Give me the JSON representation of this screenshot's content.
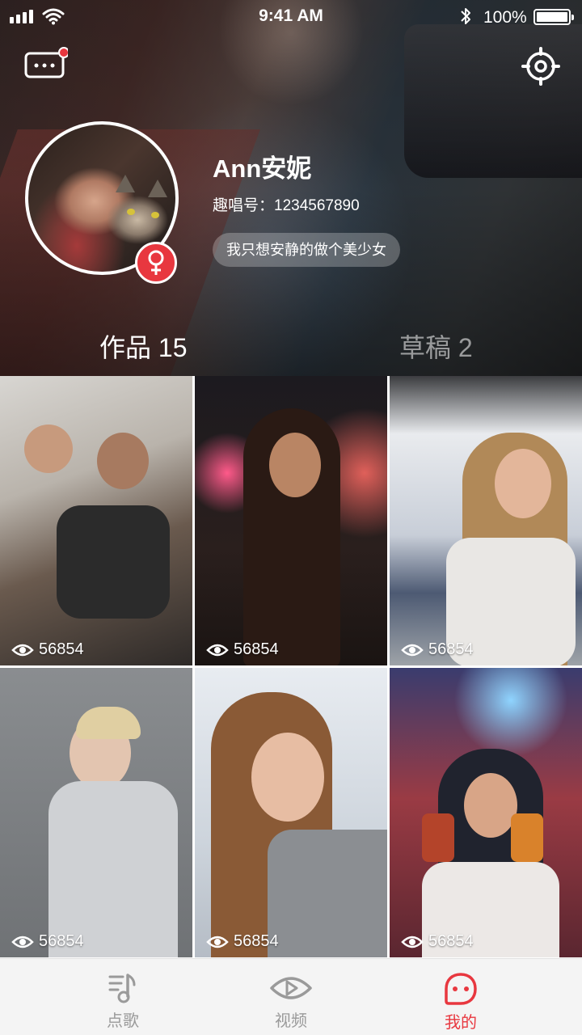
{
  "status_bar": {
    "time": "9:41 AM",
    "battery": "100%"
  },
  "profile": {
    "name": "Ann安妮",
    "id_line": "趣唱号：1234567890",
    "bio": "我只想安静的做个美少女"
  },
  "tabs": [
    {
      "label": "作品 15",
      "active": true
    },
    {
      "label": "草稿 2",
      "active": false
    }
  ],
  "works": [
    {
      "views": "56854"
    },
    {
      "views": "56854"
    },
    {
      "views": "56854"
    },
    {
      "views": "56854"
    },
    {
      "views": "56854"
    },
    {
      "views": "56854"
    }
  ],
  "nav": [
    {
      "label": "点歌",
      "icon": "music-note-icon"
    },
    {
      "label": "视频",
      "icon": "eye-icon"
    },
    {
      "label": "我的",
      "icon": "smile-icon",
      "active": true
    }
  ],
  "colors": {
    "accent": "#e8373f",
    "nav_inactive": "#9a9a9a"
  }
}
